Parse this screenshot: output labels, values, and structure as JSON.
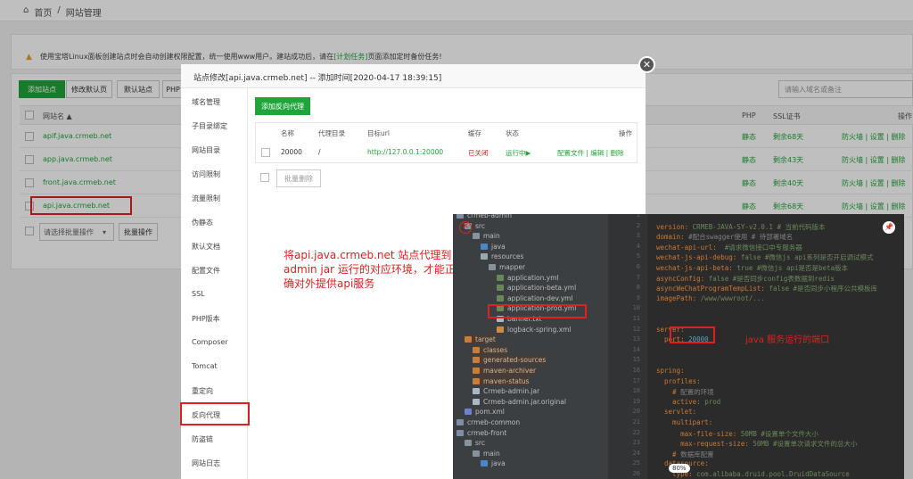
{
  "breadcrumb": {
    "home": "首页",
    "sep": "/",
    "current": "网站管理"
  },
  "notice": {
    "pre": "使用宝塔Linux面板创建站点时会自动创建权限配置，统一使用www用户。建站成功后，请在",
    "link": "[计划任务]",
    "post": "页面添加定时备份任务!"
  },
  "toolbar": {
    "add_site": "添加站点",
    "edit_default_page": "修改默认页",
    "default_site": "默认站点",
    "php_cmd": "PHP",
    "search_placeholder": "请输入域名或备注"
  },
  "table": {
    "col_name": "网站名 ▲",
    "col_php": "PHP",
    "col_ssl": "SSL证书",
    "col_ops": "操作",
    "rows": [
      {
        "name": "apif.java.crmeb.net",
        "php": "静态",
        "ssl": "剩余68天",
        "ops": "防火墙 | 设置 | 删除"
      },
      {
        "name": "app.java.crmeb.net",
        "php": "静态",
        "ssl": "剩余43天",
        "ops": "防火墙 | 设置 | 删除"
      },
      {
        "name": "front.java.crmeb.net",
        "php": "静态",
        "ssl": "剩余40天",
        "ops": "防火墙 | 设置 | 删除"
      },
      {
        "name": "api.java.crmeb.net",
        "php": "静态",
        "ssl": "剩余68天",
        "ops": "防火墙 | 设置 | 删除"
      }
    ],
    "batch_select": "请选择批量操作",
    "batch_btn": "批量操作"
  },
  "modal": {
    "title": "站点修改[api.java.crmeb.net] -- 添加时间[2020-04-17 18:39:15]",
    "menu": [
      "域名管理",
      "子目录绑定",
      "网站目录",
      "访问限制",
      "流量限制",
      "伪静态",
      "默认文档",
      "配置文件",
      "SSL",
      "PHP版本",
      "Composer",
      "Tomcat",
      "重定向",
      "反向代理",
      "防盗链",
      "网站日志"
    ],
    "add_proxy": "添加反向代理",
    "proxy_cols": {
      "name": "名称",
      "dir": "代理目录",
      "url": "目标url",
      "cache": "缓存",
      "status": "状态",
      "ops": "操作"
    },
    "proxy_row": {
      "name": "20000",
      "dir": "/",
      "url": "http://127.0.0.1:20000",
      "cache": "已关闭",
      "status": "运行中▶",
      "ops": "配置文件 | 编辑 | 删除"
    },
    "batch_delete": "批量删除"
  },
  "annotation": {
    "text": "将api.java.crmeb.net 站点代理到 admin jar 运行的对应环境，才能正确对外提供api服务",
    "port_note": "java 服务运行的端口"
  },
  "ide": {
    "tree": [
      {
        "t": "crmeb-admin",
        "d": 0,
        "ico": "mod"
      },
      {
        "t": "src",
        "d": 1,
        "ico": "dir"
      },
      {
        "t": "main",
        "d": 2,
        "ico": "dir"
      },
      {
        "t": "java",
        "d": 3,
        "ico": "src"
      },
      {
        "t": "resources",
        "d": 3,
        "ico": "res"
      },
      {
        "t": "mapper",
        "d": 4,
        "ico": "dir"
      },
      {
        "t": "application.yml",
        "d": 5,
        "ico": "yml"
      },
      {
        "t": "application-beta.yml",
        "d": 5,
        "ico": "yml"
      },
      {
        "t": "application-dev.yml",
        "d": 5,
        "ico": "yml"
      },
      {
        "t": "application-prod.yml",
        "d": 5,
        "ico": "yml"
      },
      {
        "t": "banner.txt",
        "d": 5,
        "ico": "txt"
      },
      {
        "t": "logback-spring.xml",
        "d": 5,
        "ico": "xml"
      },
      {
        "t": "target",
        "d": 1,
        "ico": "tgt"
      },
      {
        "t": "classes",
        "d": 2,
        "ico": "tgt"
      },
      {
        "t": "generated-sources",
        "d": 2,
        "ico": "tgt"
      },
      {
        "t": "maven-archiver",
        "d": 2,
        "ico": "tgt"
      },
      {
        "t": "maven-status",
        "d": 2,
        "ico": "tgt"
      },
      {
        "t": "Crmeb-admin.jar",
        "d": 2,
        "ico": "jar"
      },
      {
        "t": "Crmeb-admin.jar.original",
        "d": 2,
        "ico": "file"
      },
      {
        "t": "pom.xml",
        "d": 1,
        "ico": "pom"
      },
      {
        "t": "crmeb-common",
        "d": 0,
        "ico": "mod"
      },
      {
        "t": "crmeb-front",
        "d": 0,
        "ico": "mod"
      },
      {
        "t": "src",
        "d": 1,
        "ico": "dir"
      },
      {
        "t": "main",
        "d": 2,
        "ico": "dir"
      },
      {
        "t": "java",
        "d": 3,
        "ico": "src"
      }
    ],
    "lines": [
      [
        "",
        ""
      ],
      [
        "version: ",
        "CRMEB-JAVA-SY-v2.0.1 # 当前代码版本"
      ],
      [
        "domain: ",
        "#配合swagger使用 # 待部署域名"
      ],
      [
        "wechat-api-url: ",
        " #请求微信接口中专服务器"
      ],
      [
        "wechat-js-api-debug: ",
        "false #微信js api系列是否开启调试模式"
      ],
      [
        "wechat-js-api-beta: ",
        "true #微信js api是否是beta版本"
      ],
      [
        "asyncConfig: ",
        "false #是否同步config表数据到redis"
      ],
      [
        "asyncWeChatProgramTempList: ",
        "false #是否同步小程序公共模板库"
      ],
      [
        "imagePath: ",
        "/www/wwwroot/..."
      ],
      [
        "",
        ""
      ],
      [
        "",
        ""
      ],
      [
        "server:",
        ""
      ],
      [
        "  port: ",
        "20000"
      ],
      [
        "",
        ""
      ],
      [
        "",
        ""
      ],
      [
        "spring:",
        ""
      ],
      [
        "  profiles:",
        ""
      ],
      [
        "    # ",
        "配置的环境"
      ],
      [
        "    active: ",
        "prod"
      ],
      [
        "  servlet:",
        ""
      ],
      [
        "    multipart:",
        ""
      ],
      [
        "      max-file-size: ",
        "50MB #设置单个文件大小"
      ],
      [
        "      max-request-size: ",
        "50MB #设置单次请求文件的总大小"
      ],
      [
        "    # ",
        "数据库配置"
      ],
      [
        "  datasource:",
        ""
      ],
      [
        "    type: ",
        "com.alibaba.druid.pool.DruidDataSource"
      ]
    ],
    "line_start": 1,
    "zoom": "80%"
  }
}
